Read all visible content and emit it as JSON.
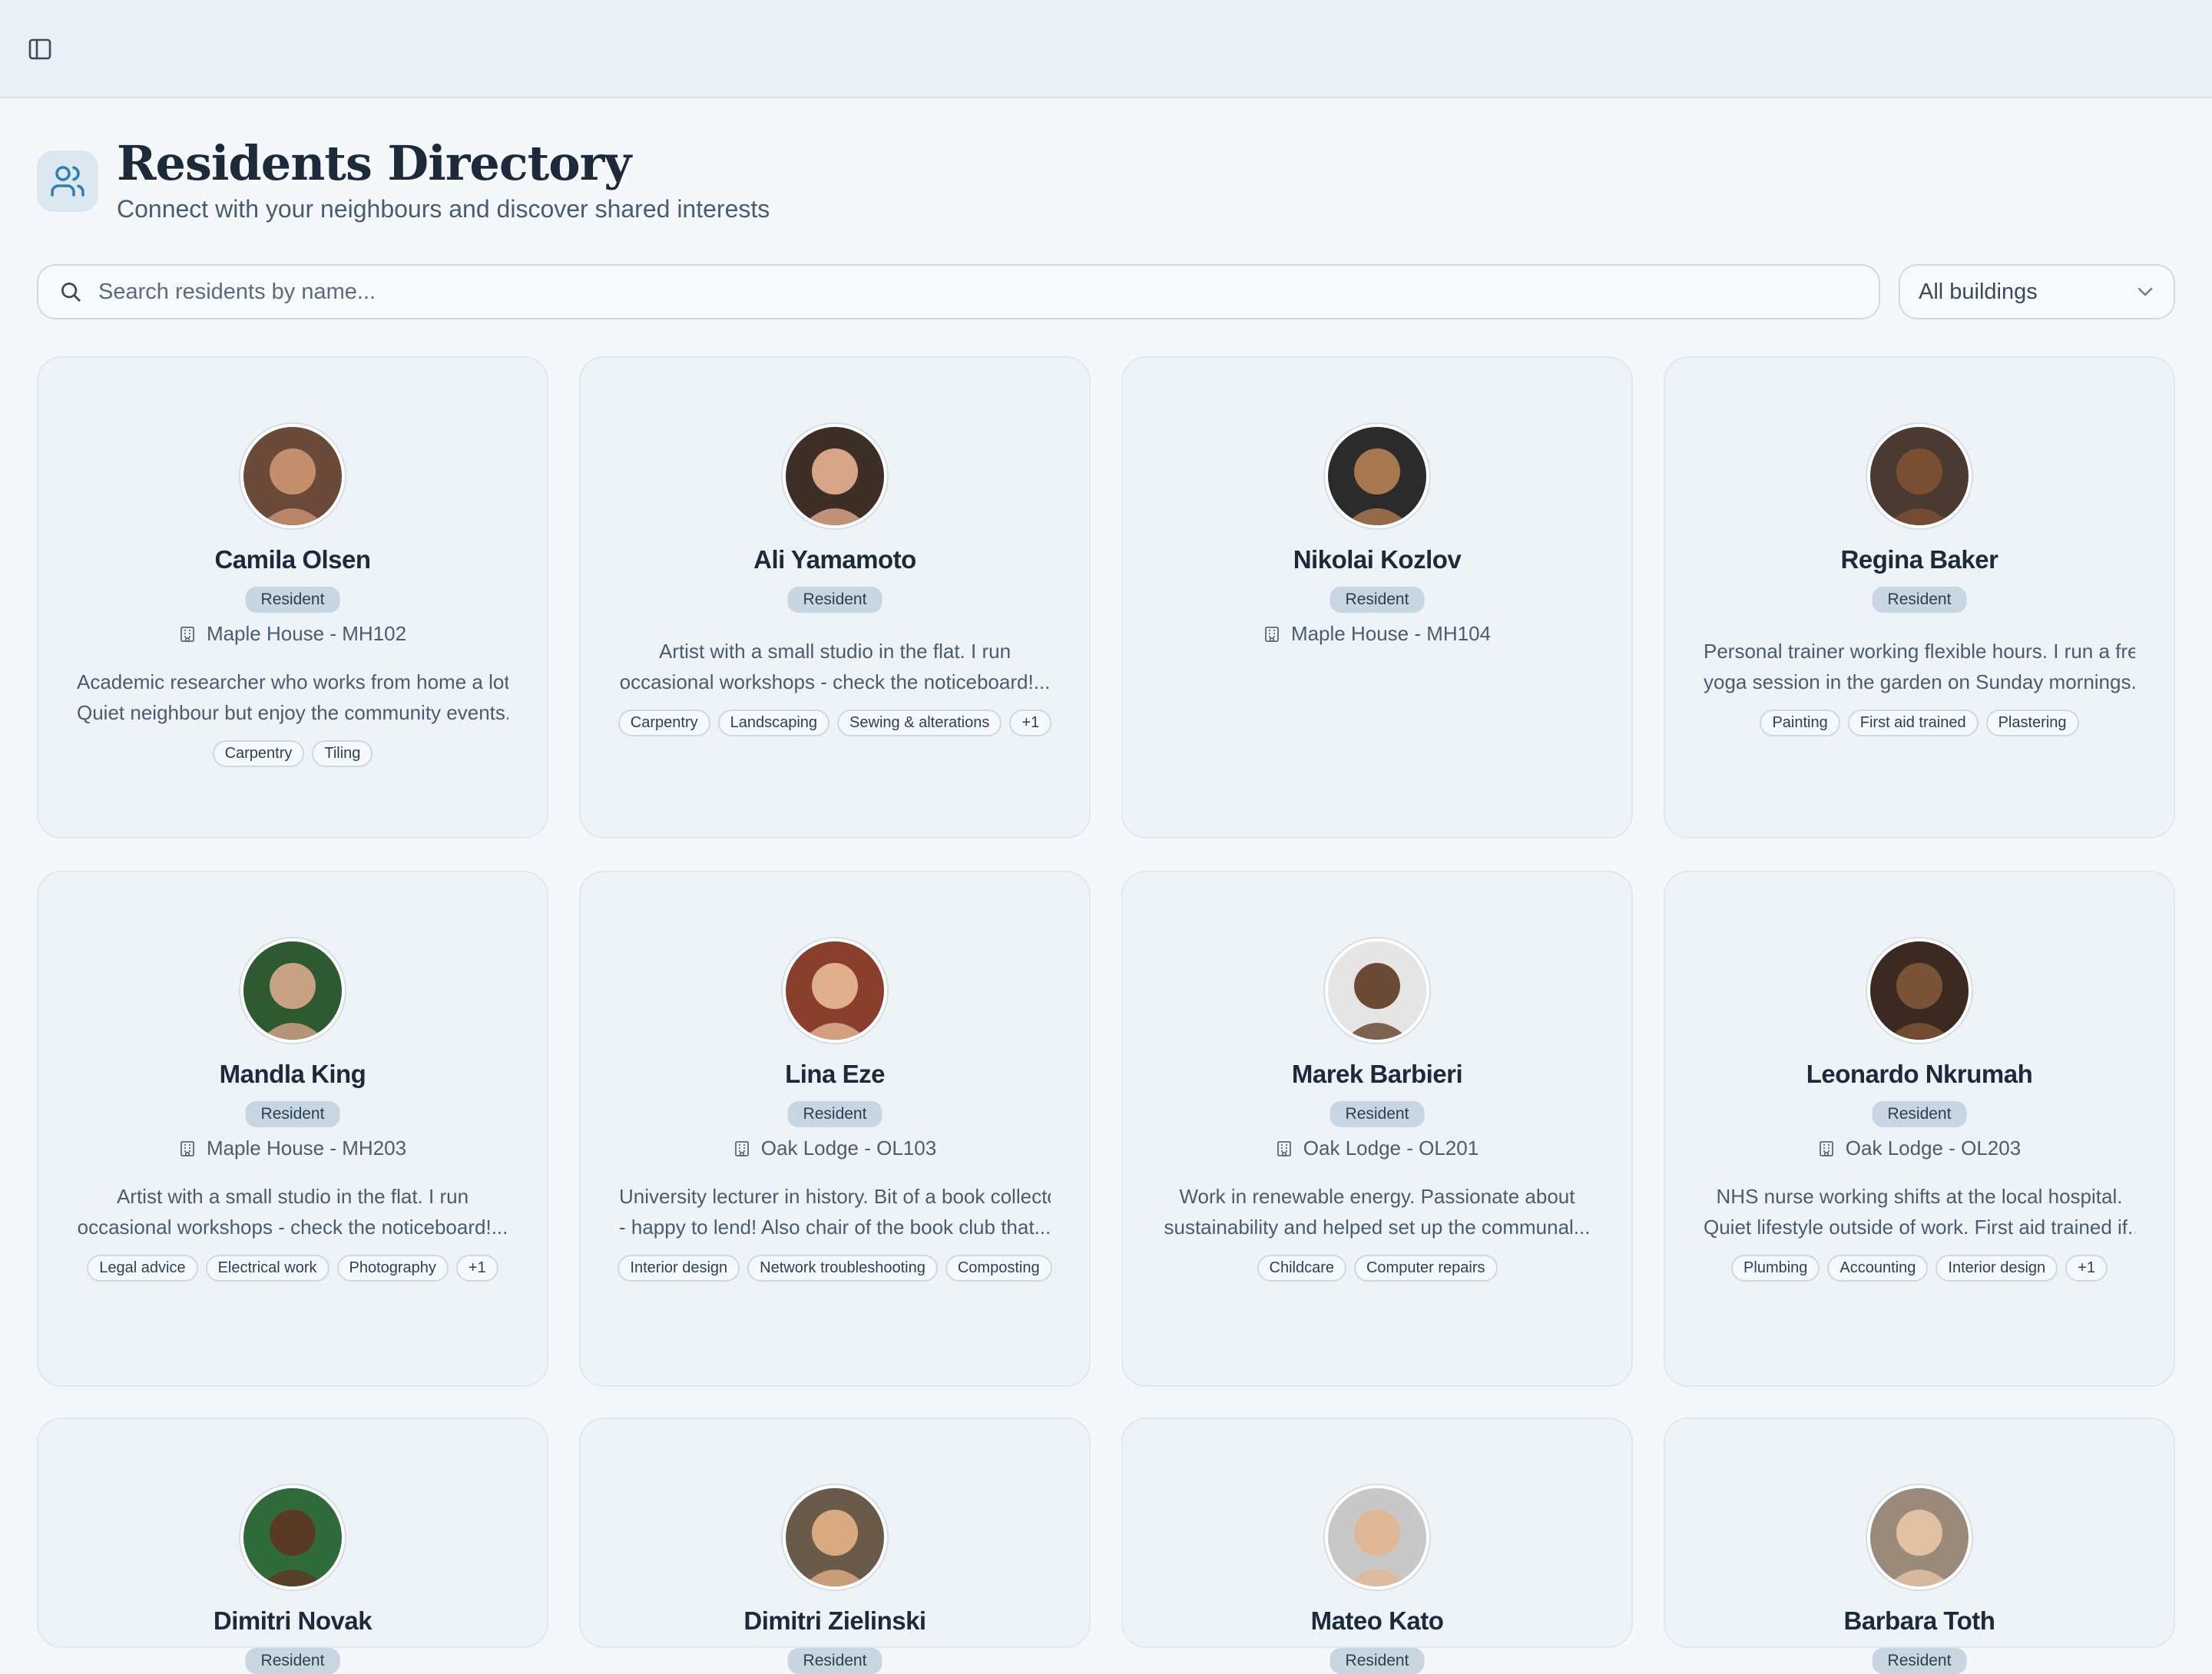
{
  "topbar": {
    "toggle_icon": "sidebar-toggle-icon"
  },
  "header": {
    "icon": "users-icon",
    "title": "Residents Directory",
    "subtitle": "Connect with your neighbours and discover shared interests"
  },
  "search": {
    "placeholder": "Search residents by name..."
  },
  "building_filter": {
    "selected": "All buildings"
  },
  "colors": {
    "accent": "#2f7fb5",
    "card": "#eef3f8",
    "badge": "#c7d6e1"
  },
  "residents": [
    {
      "name": "Camila Olsen",
      "role": "Resident",
      "building": "Maple House - MH102",
      "bio": [
        "Academic researcher who works from home a lot.",
        "Quiet neighbour but enjoy the community events..."
      ],
      "skills": [
        "Carpentry",
        "Tiling"
      ]
    },
    {
      "name": "Ali Yamamoto",
      "role": "Resident",
      "building": "",
      "bio": [
        "Artist with a small studio in the flat. I run",
        "occasional workshops - check the noticeboard!..."
      ],
      "skills": [
        "Carpentry",
        "Landscaping",
        "Sewing & alterations",
        "+1"
      ]
    },
    {
      "name": "Nikolai Kozlov",
      "role": "Resident",
      "building": "Maple House - MH104",
      "bio": [],
      "skills": []
    },
    {
      "name": "Regina Baker",
      "role": "Resident",
      "building": "",
      "bio": [
        "Personal trainer working flexible hours. I run a free",
        "yoga session in the garden on Sunday mornings..."
      ],
      "skills": [
        "Painting",
        "First aid trained",
        "Plastering"
      ]
    },
    {
      "name": "Mandla King",
      "role": "Resident",
      "building": "Maple House - MH203",
      "bio": [
        "Artist with a small studio in the flat. I run",
        "occasional workshops - check the noticeboard!..."
      ],
      "skills": [
        "Legal advice",
        "Electrical work",
        "Photography",
        "+1"
      ]
    },
    {
      "name": "Lina Eze",
      "role": "Resident",
      "building": "Oak Lodge - OL103",
      "bio": [
        "University lecturer in history. Bit of a book collector",
        "- happy to lend! Also chair of the book club that..."
      ],
      "skills": [
        "Interior design",
        "Network troubleshooting",
        "Composting"
      ]
    },
    {
      "name": "Marek Barbieri",
      "role": "Resident",
      "building": "Oak Lodge - OL201",
      "bio": [
        "Work in renewable energy. Passionate about",
        "sustainability and helped set up the communal..."
      ],
      "skills": [
        "Childcare",
        "Computer repairs"
      ]
    },
    {
      "name": "Leonardo Nkrumah",
      "role": "Resident",
      "building": "Oak Lodge - OL203",
      "bio": [
        "NHS nurse working shifts at the local hospital.",
        "Quiet lifestyle outside of work. First aid trained if..."
      ],
      "skills": [
        "Plumbing",
        "Accounting",
        "Interior design",
        "+1"
      ]
    },
    {
      "name": "Dimitri Novak",
      "role": "Resident",
      "building": "",
      "bio": [],
      "skills": []
    },
    {
      "name": "Dimitri Zielinski",
      "role": "Resident",
      "building": "",
      "bio": [],
      "skills": []
    },
    {
      "name": "Mateo Kato",
      "role": "Resident",
      "building": "",
      "bio": [],
      "skills": []
    },
    {
      "name": "Barbara Toth",
      "role": "Resident",
      "building": "",
      "bio": [],
      "skills": []
    }
  ]
}
